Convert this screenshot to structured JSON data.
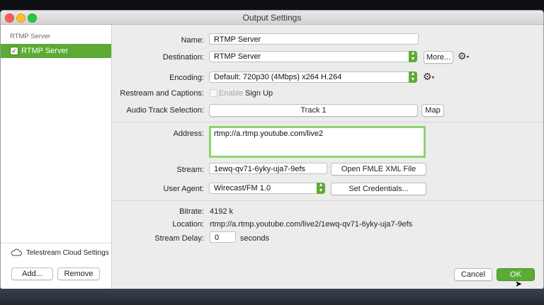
{
  "window": {
    "title": "Output Settings"
  },
  "sidebar": {
    "heading": "RTMP Server",
    "items": [
      {
        "label": "RTMP Server",
        "checked": true
      }
    ],
    "cloud_settings": "Telestream Cloud Settings",
    "add_button": "Add...",
    "remove_button": "Remove"
  },
  "form": {
    "name": {
      "label": "Name:",
      "value": "RTMP Server"
    },
    "destination": {
      "label": "Destination:",
      "value": "RTMP Server",
      "more_button": "More..."
    },
    "encoding": {
      "label": "Encoding:",
      "value": "Default: 720p30 (4Mbps) x264 H.264"
    },
    "restream": {
      "label": "Restream and Captions:",
      "enable_label": "Enable",
      "signup_label": "Sign Up"
    },
    "audio_track": {
      "label": "Audio Track Selection:",
      "value": "Track 1",
      "map_button": "Map"
    },
    "address": {
      "label": "Address:",
      "value": "rtmp://a.rtmp.youtube.com/live2"
    },
    "stream": {
      "label": "Stream:",
      "value": "1ewq-qv71-6yky-uja7-9efs",
      "open_button": "Open FMLE XML File"
    },
    "user_agent": {
      "label": "User Agent:",
      "value": "Wirecast/FM 1.0",
      "credentials_button": "Set Credentials..."
    },
    "bitrate": {
      "label": "Bitrate:",
      "value": "4192 k"
    },
    "location": {
      "label": "Location:",
      "value": "rtmp://a.rtmp.youtube.com/live2/1ewq-qv71-6yky-uja7-9efs"
    },
    "stream_delay": {
      "label": "Stream Delay:",
      "value": "0",
      "unit": "seconds"
    }
  },
  "footer": {
    "cancel_button": "Cancel",
    "ok_button": "OK"
  },
  "colors": {
    "accent": "#5bab34",
    "focus_ring": "#8fd36c"
  },
  "icons": [
    "gear-icon",
    "cloud-icon",
    "chevron-updown-icon",
    "checkbox-icon",
    "pointer-cursor-icon"
  ]
}
